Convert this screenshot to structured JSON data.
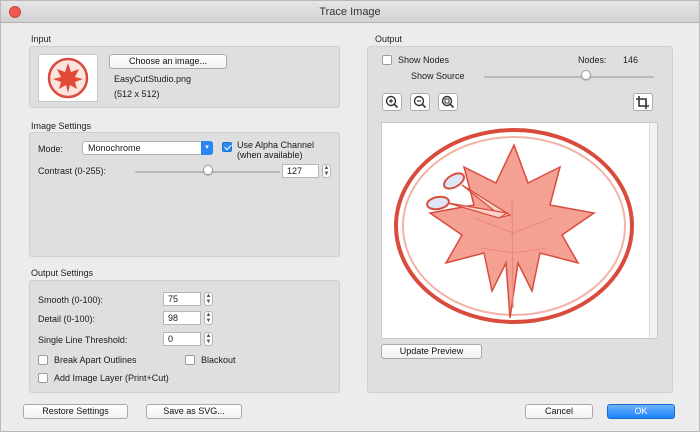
{
  "window": {
    "title": "Trace Image"
  },
  "input": {
    "group_label": "Input",
    "choose_button": "Choose an image...",
    "filename": "EasyCutStudio.png",
    "dimensions": "(512 x 512)"
  },
  "image_settings": {
    "group_label": "Image Settings",
    "mode_label": "Mode:",
    "mode_value": "Monochrome",
    "alpha_label": "Use Alpha Channel",
    "alpha_sublabel": "(when available)",
    "alpha_checked": true,
    "contrast_label": "Contrast (0-255):",
    "contrast_value": "127",
    "contrast_slider_fraction": 0.5
  },
  "output_settings": {
    "group_label": "Output Settings",
    "smooth_label": "Smooth (0-100):",
    "smooth_value": "75",
    "detail_label": "Detail (0-100):",
    "detail_value": "98",
    "threshold_label": "Single Line Threshold:",
    "threshold_value": "0",
    "break_apart_label": "Break Apart Outlines",
    "blackout_label": "Blackout",
    "add_image_layer_label": "Add Image Layer (Print+Cut)"
  },
  "output": {
    "group_label": "Output",
    "show_nodes_label": "Show Nodes",
    "nodes_label": "Nodes:",
    "nodes_value": "146",
    "show_source_label": "Show Source",
    "show_source_fraction": 0.6,
    "update_preview_button": "Update Preview"
  },
  "footer": {
    "restore_button": "Restore Settings",
    "save_svg_button": "Save as SVG...",
    "cancel_button": "Cancel",
    "ok_button": "OK"
  },
  "colors": {
    "accent": "#2a86f3",
    "trace_red": "#d94c3d",
    "trace_fill": "#f4a093"
  },
  "icons": [
    "zoom-in-icon",
    "zoom-out-icon",
    "zoom-fit-icon",
    "crop-icon",
    "scissors-icon",
    "maple-leaf-icon"
  ]
}
